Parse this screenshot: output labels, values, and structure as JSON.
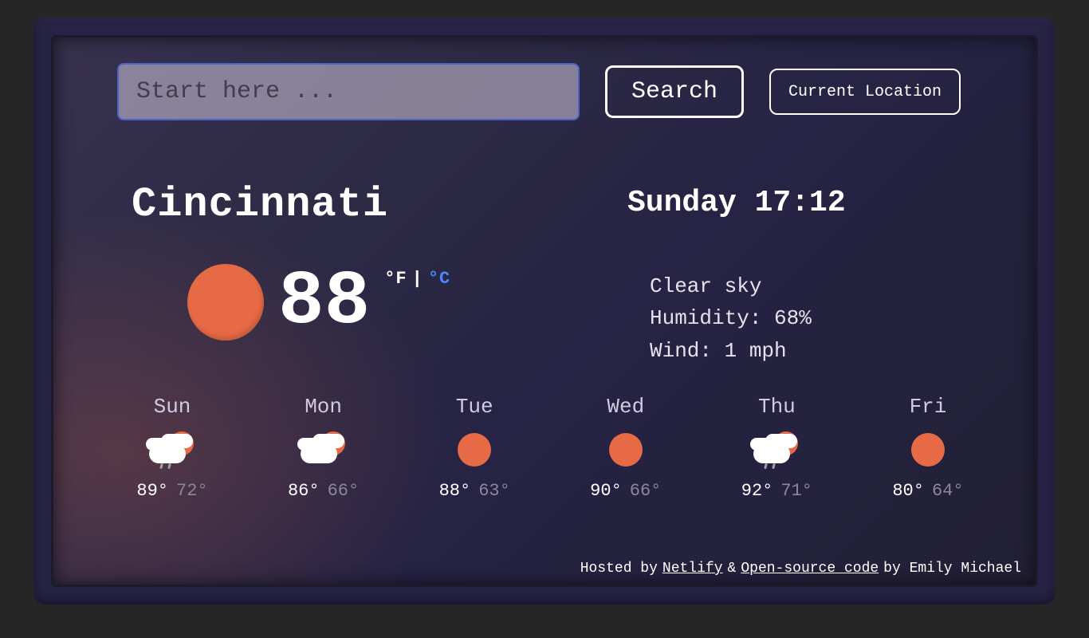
{
  "search": {
    "placeholder": "Start here ...",
    "value": "",
    "search_label": "Search",
    "current_location_label": "Current Location"
  },
  "location": {
    "city": "Cincinnati",
    "day_time": "Sunday 17:12"
  },
  "current": {
    "icon": "sun",
    "temp": "88",
    "unit_f": "°F",
    "unit_sep": "|",
    "unit_c": "°C",
    "condition": "Clear sky",
    "humidity_line": "Humidity: 68%",
    "wind_line": "Wind: 1 mph"
  },
  "forecast": [
    {
      "day": "Sun",
      "icon": "cloud-sun-rain",
      "hi": "89°",
      "lo": "72°"
    },
    {
      "day": "Mon",
      "icon": "cloud-sun",
      "hi": "86°",
      "lo": "66°"
    },
    {
      "day": "Tue",
      "icon": "sun",
      "hi": "88°",
      "lo": "63°"
    },
    {
      "day": "Wed",
      "icon": "sun",
      "hi": "90°",
      "lo": "66°"
    },
    {
      "day": "Thu",
      "icon": "cloud-sun-rain",
      "hi": "92°",
      "lo": "71°"
    },
    {
      "day": "Fri",
      "icon": "sun",
      "hi": "80°",
      "lo": "64°"
    }
  ],
  "footer": {
    "prefix": "Hosted by",
    "host_link": "Netlify",
    "amp": "&",
    "code_link": "Open-source code",
    "by": "by Emily Michael"
  }
}
